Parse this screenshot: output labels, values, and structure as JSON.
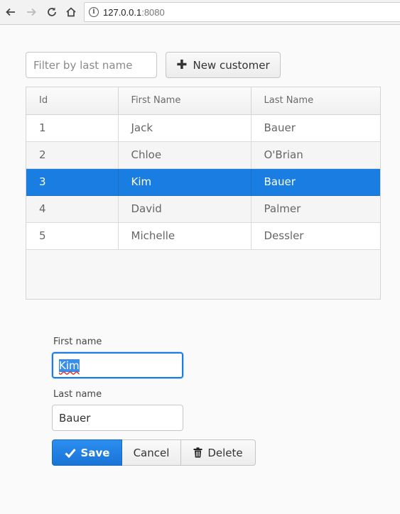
{
  "browser": {
    "address_host": "127.0.0.1",
    "address_port": ":8080",
    "info_glyph": "i"
  },
  "toolbar": {
    "filter_placeholder": "Filter by last name",
    "filter_value": "",
    "new_customer_label": "New customer",
    "new_customer_icon": "plus-icon"
  },
  "grid": {
    "columns": [
      "Id",
      "First Name",
      "Last Name"
    ],
    "rows": [
      {
        "id": "1",
        "first": "Jack",
        "last": "Bauer",
        "selected": false
      },
      {
        "id": "2",
        "first": "Chloe",
        "last": "O'Brian",
        "selected": false
      },
      {
        "id": "3",
        "first": "Kim",
        "last": "Bauer",
        "selected": true
      },
      {
        "id": "4",
        "first": "David",
        "last": "Palmer",
        "selected": false
      },
      {
        "id": "5",
        "first": "Michelle",
        "last": "Dessler",
        "selected": false
      }
    ]
  },
  "form": {
    "first_name_label": "First name",
    "first_name_value": "Kim",
    "last_name_label": "Last name",
    "last_name_value": "Bauer",
    "save_label": "Save",
    "cancel_label": "Cancel",
    "delete_label": "Delete"
  },
  "colors": {
    "accent": "#197de1",
    "selected_row": "#197de1",
    "background": "#fafafa"
  }
}
